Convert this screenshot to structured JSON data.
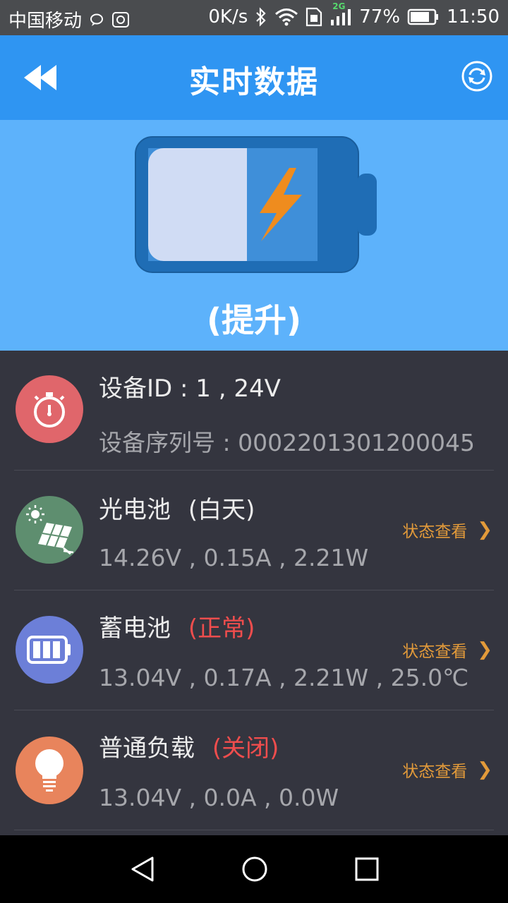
{
  "statusbar": {
    "carrier": "中国移动",
    "net_speed": "0K/s",
    "network_type": "2G",
    "battery_pct": "77%",
    "time": "11:50",
    "icons": [
      "chat-icon",
      "huawei-icon",
      "bluetooth-icon",
      "wifi-icon",
      "sim-icon",
      "signal-icon",
      "battery-icon"
    ]
  },
  "appbar": {
    "title": "实时数据",
    "back_icon": "double-chevron-left-icon",
    "refresh_icon": "refresh-icon"
  },
  "hero": {
    "status": "(提升)",
    "charge_fraction": 0.5,
    "icon": "battery-charging-icon"
  },
  "device": {
    "id_line": "设备ID : 1 , 24V",
    "serial_line": "设备序列号 : 0002201301200045",
    "icon": "stopwatch-icon"
  },
  "rows": [
    {
      "title": "光电池",
      "flag": "(白天)",
      "values": "14.26V , 0.15A , 2.21W",
      "link": "状态查看",
      "icon": "solar-panel-icon",
      "color": "#5e8e6f"
    },
    {
      "title": "蓄电池",
      "flag": "(正常)",
      "values": "13.04V , 0.17A , 2.21W , 25.0℃",
      "link": "状态查看",
      "icon": "battery-icon",
      "color": "#6c7fd8"
    },
    {
      "title": "普通负载",
      "flag": "(关闭)",
      "values": "13.04V , 0.0A , 0.0W",
      "link": "状态查看",
      "icon": "lightbulb-icon",
      "color": "#e8845c"
    }
  ],
  "colors": {
    "appbar": "#2f95f2",
    "hero": "#5db2fb",
    "list_bg": "#34353f",
    "link": "#e29a3a",
    "flag_red": "#ef4d4d"
  },
  "navbar": {
    "icons": [
      "back-triangle-icon",
      "home-circle-icon",
      "recents-square-icon"
    ]
  }
}
